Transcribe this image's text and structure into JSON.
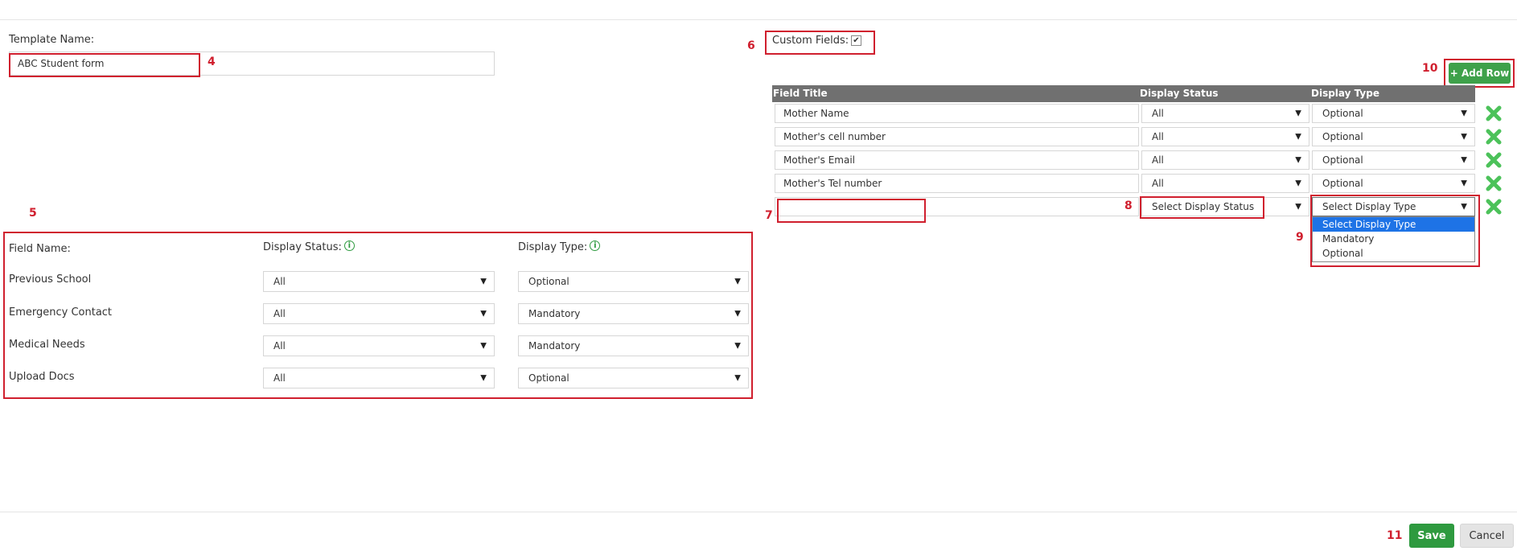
{
  "template": {
    "name_label": "Template Name:",
    "name_value": "ABC Student form"
  },
  "fields_section": {
    "field_name_header": "Field Name:",
    "display_status_header": "Display Status:",
    "display_type_header": "Display Type:",
    "rows": [
      {
        "name": "Previous School",
        "status": "All",
        "type": "Optional"
      },
      {
        "name": "Emergency Contact",
        "status": "All",
        "type": "Mandatory"
      },
      {
        "name": "Medical Needs",
        "status": "All",
        "type": "Mandatory"
      },
      {
        "name": "Upload Docs",
        "status": "All",
        "type": "Optional"
      }
    ]
  },
  "custom_fields": {
    "label": "Custom Fields:",
    "checked": true,
    "add_row_label": "+ Add Row",
    "columns": [
      "Field Title",
      "Display Status",
      "Display Type"
    ],
    "rows": [
      {
        "title": "Mother Name",
        "status": "All",
        "type": "Optional"
      },
      {
        "title": "Mother's cell number",
        "status": "All",
        "type": "Optional"
      },
      {
        "title": "Mother's Email",
        "status": "All",
        "type": "Optional"
      },
      {
        "title": "Mother's Tel number",
        "status": "All",
        "type": "Optional"
      }
    ],
    "new_row": {
      "title": "",
      "status_placeholder": "Select Display Status",
      "type_placeholder": "Select Display Type"
    },
    "type_dropdown_options": [
      "Select Display Type",
      "Mandatory",
      "Optional"
    ]
  },
  "footer": {
    "save_label": "Save",
    "cancel_label": "Cancel"
  },
  "annotations": [
    "4",
    "5",
    "6",
    "7",
    "8",
    "9",
    "10",
    "11"
  ],
  "colors": {
    "accent_green": "#2e9a3f",
    "annotation_red": "#d01f2e",
    "table_header_gray": "#707070",
    "delete_green": "#4cc25a",
    "dropdown_selected_blue": "#1e73e6"
  },
  "icons": [
    "info-icon",
    "delete-icon",
    "dropdown-arrow-icon",
    "checkmark-icon",
    "plus-icon"
  ]
}
